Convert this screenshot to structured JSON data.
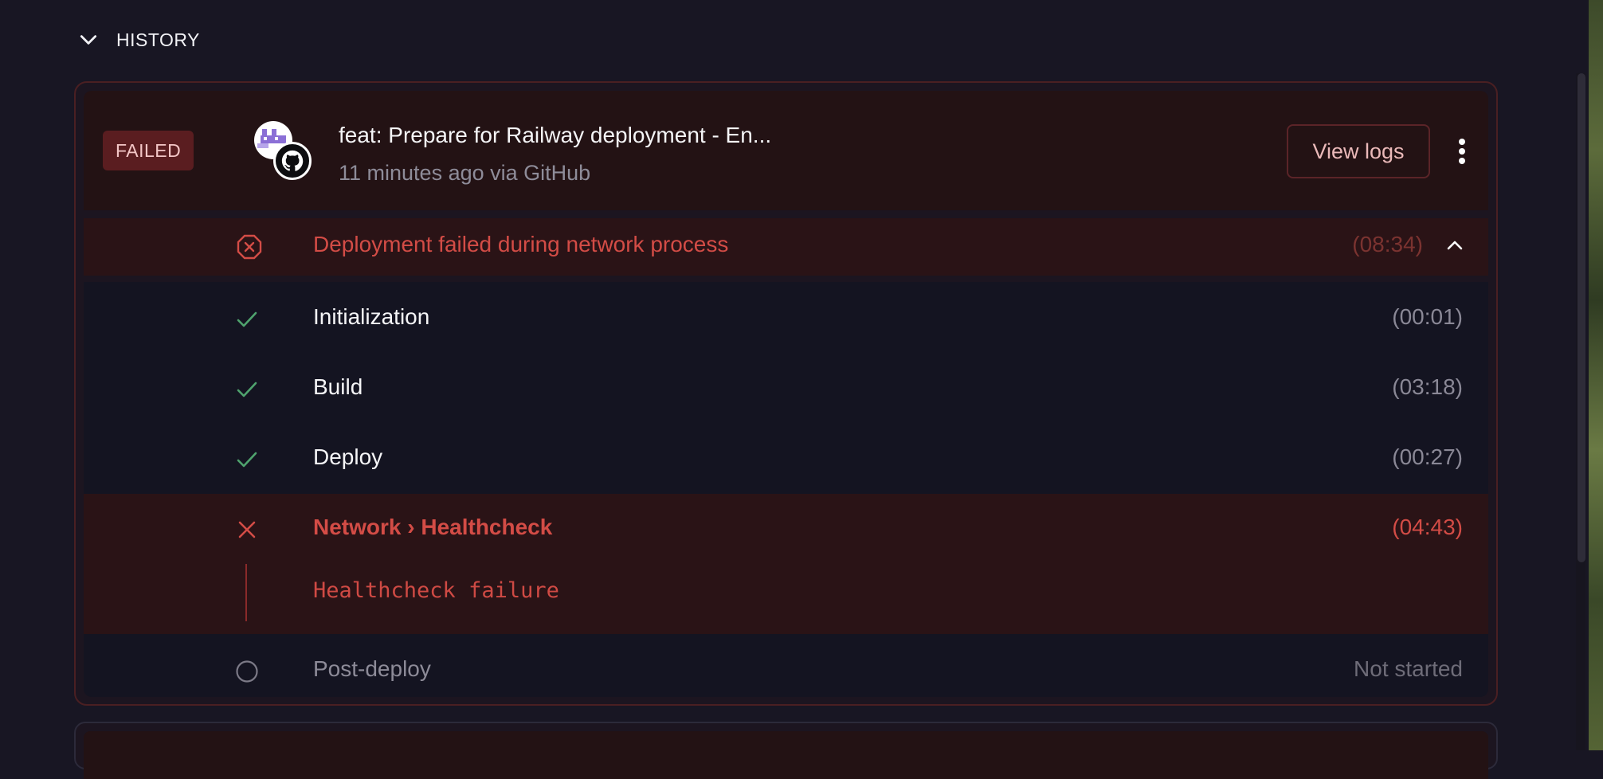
{
  "history": {
    "title": "HISTORY"
  },
  "deployment": {
    "status": "FAILED",
    "commit_title": "feat: Prepare for Railway deployment - En...",
    "commit_meta": "11 minutes ago via GitHub",
    "view_logs_label": "View logs",
    "summary": {
      "message": "Deployment failed during network process",
      "duration": "(08:34)"
    },
    "steps": [
      {
        "label": "Initialization",
        "duration": "(00:01)",
        "state": "success"
      },
      {
        "label": "Build",
        "duration": "(03:18)",
        "state": "success"
      },
      {
        "label": "Deploy",
        "duration": "(00:27)",
        "state": "success"
      },
      {
        "label": "Network › Healthcheck",
        "duration": "(04:43)",
        "state": "failed",
        "log": "Healthcheck failure"
      },
      {
        "label": "Post-deploy",
        "duration": "Not started",
        "state": "pending"
      }
    ]
  },
  "colors": {
    "background": "#181623",
    "failed_red": "#d34c46",
    "success_green": "#4fa36e",
    "badge_bg": "#5a1d20"
  },
  "icons": [
    "chevron-down-icon",
    "railway-avatar-icon",
    "github-icon",
    "more-vertical-icon",
    "error-octagon-icon",
    "chevron-up-icon",
    "check-icon",
    "x-icon",
    "pending-circle-icon"
  ]
}
